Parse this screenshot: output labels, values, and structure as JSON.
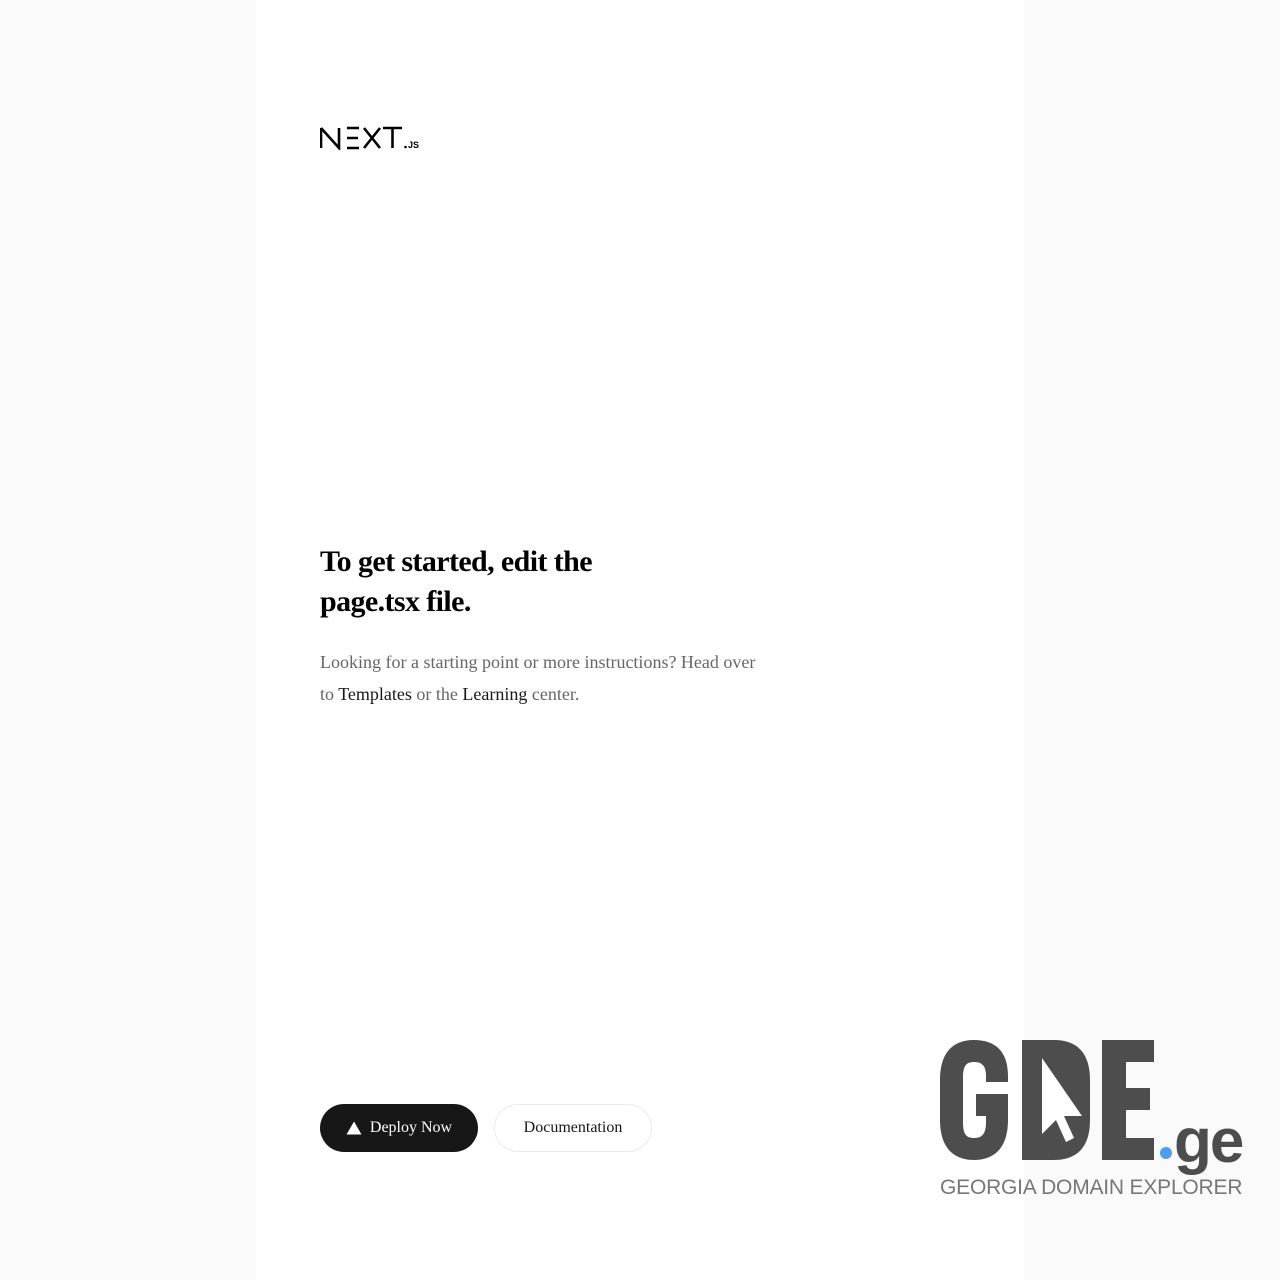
{
  "header": {
    "logo_icon": "nextjs-wordmark-icon"
  },
  "main": {
    "headline": "To get started, edit the page.tsx file.",
    "description": {
      "part1": "Looking for a starting point or more instructions? Head over to ",
      "link1": "Templates",
      "part2": " or the ",
      "link2": "Learning",
      "part3": " center."
    }
  },
  "actions": {
    "deploy_label": "Deploy Now",
    "deploy_icon": "vercel-triangle-icon",
    "docs_label": "Documentation"
  },
  "watermark": {
    "logo_icon": "gde-logo-icon",
    "tagline": "GEORGIA DOMAIN EXPLORER",
    "accent_color": "#4a9ff5",
    "logo_color": "#4d4d4d"
  },
  "colors": {
    "background": "#fafafa",
    "panel": "#ffffff",
    "primary_button": "#171717",
    "muted_text": "#666666"
  }
}
